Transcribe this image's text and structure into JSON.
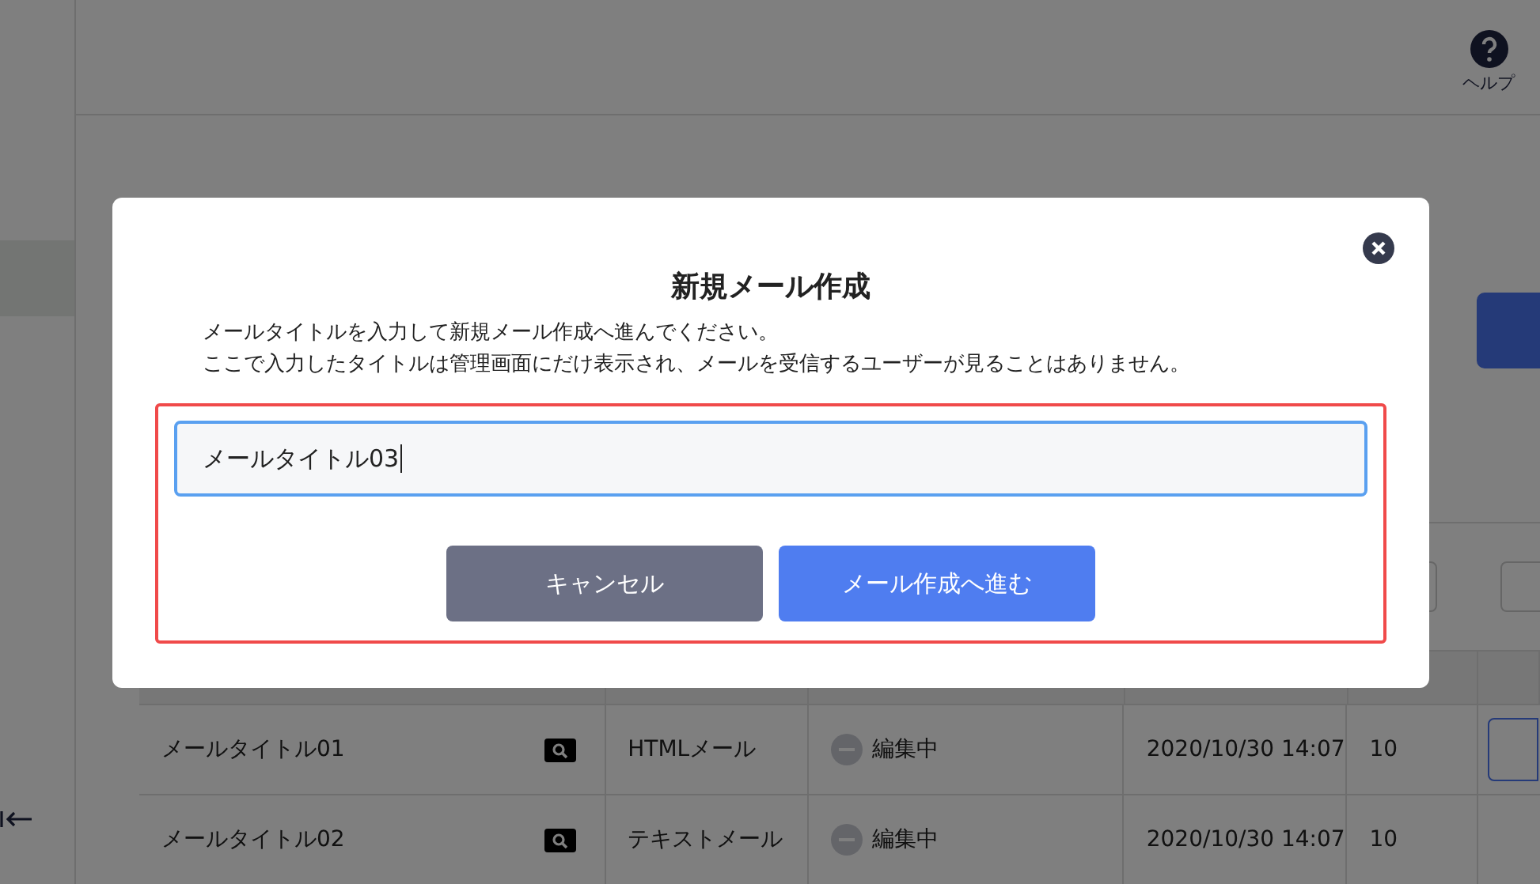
{
  "header": {
    "help_label": "ヘルプ"
  },
  "table": {
    "rows": [
      {
        "title": "メールタイトル01",
        "type": "HTMLメール",
        "status": "編集中",
        "date": "2020/10/30 14:07",
        "count": "10"
      },
      {
        "title": "メールタイトル02",
        "type": "テキストメール",
        "status": "編集中",
        "date": "2020/10/30 14:07",
        "count": "10"
      }
    ]
  },
  "dialog": {
    "title": "新規メール作成",
    "lines": [
      "メールタイトルを入力して新規メール作成へ進んでください。",
      "ここで入力したタイトルは管理画面にだけ表示され、メールを受信するユーザーが見ることはありません。"
    ],
    "input_value": "メールタイトル03",
    "cancel": "キャンセル",
    "submit": "メール作成へ進む"
  }
}
